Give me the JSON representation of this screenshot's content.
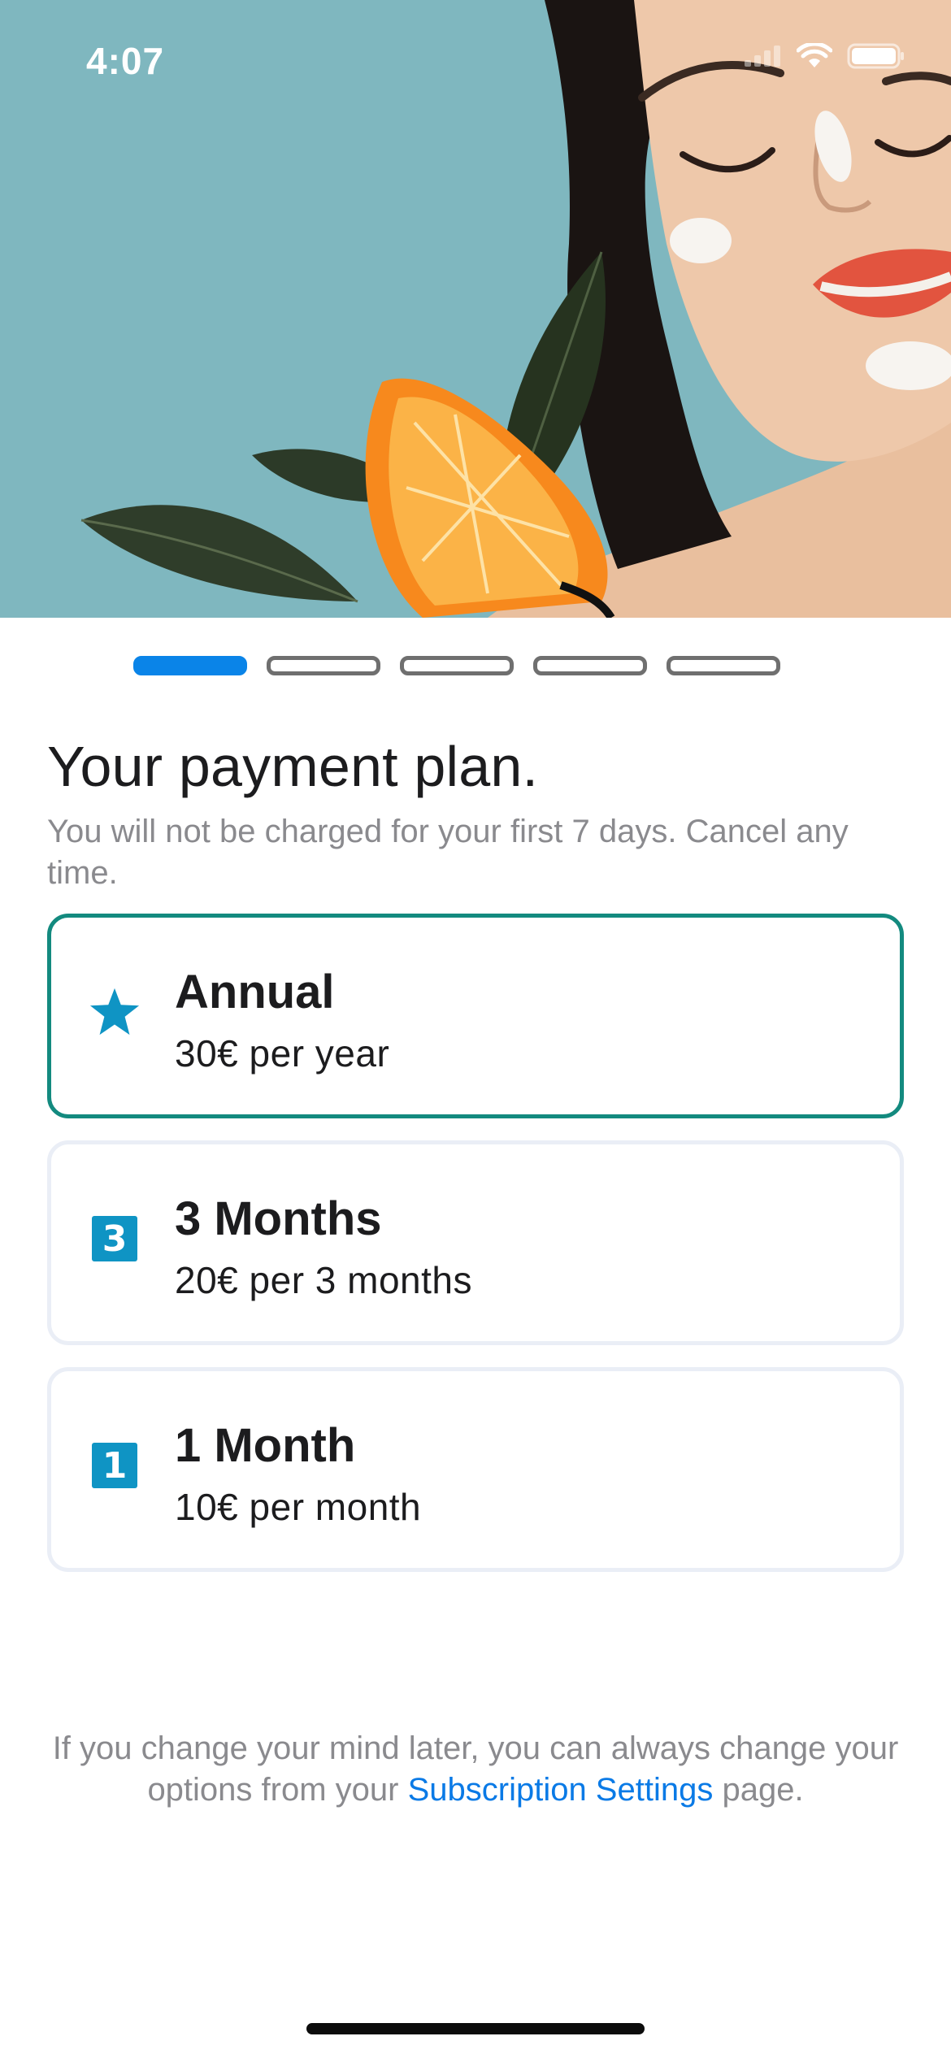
{
  "status_bar": {
    "time": "4:07",
    "icons": [
      "signal-icon",
      "wifi-icon",
      "battery-icon"
    ]
  },
  "hero": {
    "image": "woman-with-orange-slice-and-leaves-photo",
    "background_color": "#7fb7bf"
  },
  "pager": {
    "total": 5,
    "active_index": 0,
    "active_color": "#0a84e8"
  },
  "header": {
    "title": "Your payment plan.",
    "subtitle": "You will not be charged for your first 7 days. Cancel any time."
  },
  "plans": [
    {
      "icon": "star-icon",
      "name": "Annual",
      "price": "30€ per year",
      "selected": true
    },
    {
      "icon": "number-3-icon",
      "badge": "3",
      "name": "3 Months",
      "price": "20€ per 3 months",
      "selected": false
    },
    {
      "icon": "number-1-icon",
      "badge": "1",
      "name": "1 Month",
      "price": "10€ per month",
      "selected": false
    }
  ],
  "footer": {
    "text_before": "If you change your mind later, you can always change your options from your ",
    "link": "Subscription Settings",
    "text_after": " page."
  },
  "colors": {
    "accent": "#0a84e8",
    "selected_border": "#138a7f",
    "icon_blue": "#0f94c4",
    "link": "#0a7ae6"
  }
}
